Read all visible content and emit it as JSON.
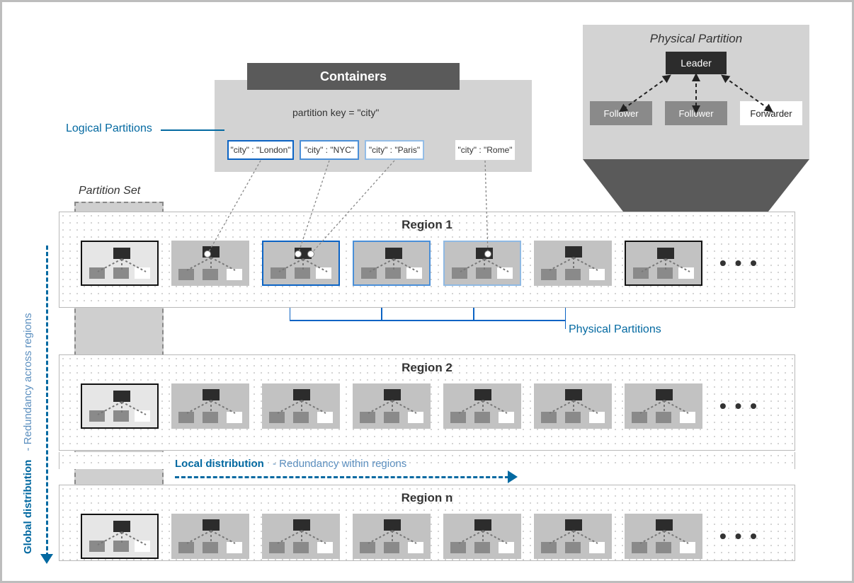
{
  "containers": {
    "title": "Containers",
    "partition_key_text": "partition key = \"city\"",
    "logical_partitions_label": "Logical Partitions",
    "items": [
      {
        "text": "\"city\" : \"London\""
      },
      {
        "text": "\"city\" : \"NYC\""
      },
      {
        "text": "\"city\" : \"Paris\""
      },
      {
        "text": "\"city\" : \"Rome\""
      }
    ]
  },
  "physical_partition_callout": {
    "title": "Physical Partition",
    "leader": "Leader",
    "follower": "Follower",
    "forwarder": "Forwarder"
  },
  "partition_set_label": "Partition Set",
  "regions": [
    {
      "label": "Region 1"
    },
    {
      "label": "Region 2"
    },
    {
      "label": "Region n"
    }
  ],
  "physical_partitions_label": "Physical Partitions",
  "global_distribution": {
    "title": "Global distribution",
    "subtitle": "-  Redundancy across regions"
  },
  "local_distribution": {
    "title": "Local distribution",
    "subtitle": "-  Redundancy within regions"
  },
  "ellipsis": "• • •"
}
